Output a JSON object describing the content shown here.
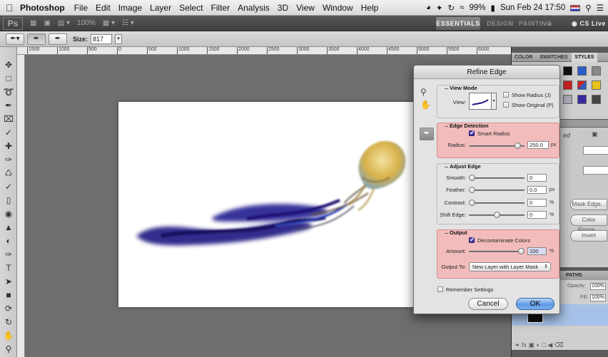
{
  "menubar": {
    "items": [
      "Photoshop",
      "File",
      "Edit",
      "Image",
      "Layer",
      "Select",
      "Filter",
      "Analysis",
      "3D",
      "View",
      "Window",
      "Help"
    ],
    "battery": "99%",
    "clock": "Sun Feb 24  17:50"
  },
  "appbar": {
    "logo": "Ps",
    "zoom": "100%",
    "workspaces": {
      "essentials": "ESSENTIALS",
      "design": "DESIGN",
      "painting": "PAINTING",
      "more": "»"
    },
    "cs_live": "CS Live"
  },
  "options": {
    "size_label": "Size:",
    "size_value": "817"
  },
  "ruler": {
    "ticks": [
      "1500",
      "1000",
      "500",
      "0",
      "500",
      "1000",
      "1500",
      "2000",
      "2500",
      "3000",
      "3500",
      "4000",
      "4500",
      "5000",
      "5500",
      "6000"
    ]
  },
  "panels": {
    "swatch_tabs": [
      "COLOR",
      "SWATCHES",
      "STYLES"
    ],
    "mask_buttons": [
      "Mask Edge...",
      "Color Range...",
      "Invert"
    ],
    "mask_side_label": "ed",
    "layers_tabs": [
      "PATHS"
    ],
    "opacity_label": "Opacity:",
    "opacity_value": "100%",
    "fill_label": "Fill:",
    "fill_value": "100%"
  },
  "dialog": {
    "title": "Refine Edge",
    "view_mode": {
      "title": "View Mode",
      "view_label": "View:",
      "show_radius": "Show Radius (J)",
      "show_original": "Show Original (P)"
    },
    "edge_detection": {
      "title": "Edge Detection",
      "smart_radius": "Smart Radius",
      "radius_label": "Radius:",
      "radius_value": "250.0",
      "radius_unit": "px",
      "radius_level": 0.93
    },
    "adjust_edge": {
      "title": "Adjust Edge",
      "smooth_label": "Smooth:",
      "smooth_value": "0",
      "smooth_level": 0.0,
      "feather_label": "Feather:",
      "feather_value": "0.0",
      "feather_unit": "px",
      "feather_level": 0.0,
      "contrast_label": "Contrast:",
      "contrast_value": "0",
      "contrast_unit": "%",
      "contrast_level": 0.0,
      "shift_label": "Shift Edge:",
      "shift_value": "0",
      "shift_unit": "%",
      "shift_level": 0.5
    },
    "output": {
      "title": "Output",
      "decontaminate": "Decontaminate Colors",
      "amount_label": "Amount:",
      "amount_value": "100",
      "amount_unit": "%",
      "amount_level": 1.0,
      "output_to_label": "Output To:",
      "output_to_value": "New Layer with Layer Mask"
    },
    "remember": "Remember Settings",
    "cancel": "Cancel",
    "ok": "OK"
  },
  "colors": {
    "highlight": "#f2bcbc",
    "ok_button": "#5f9ae6",
    "jelly_blue": "#1c1580",
    "jelly_gold": "#d8b24a"
  }
}
